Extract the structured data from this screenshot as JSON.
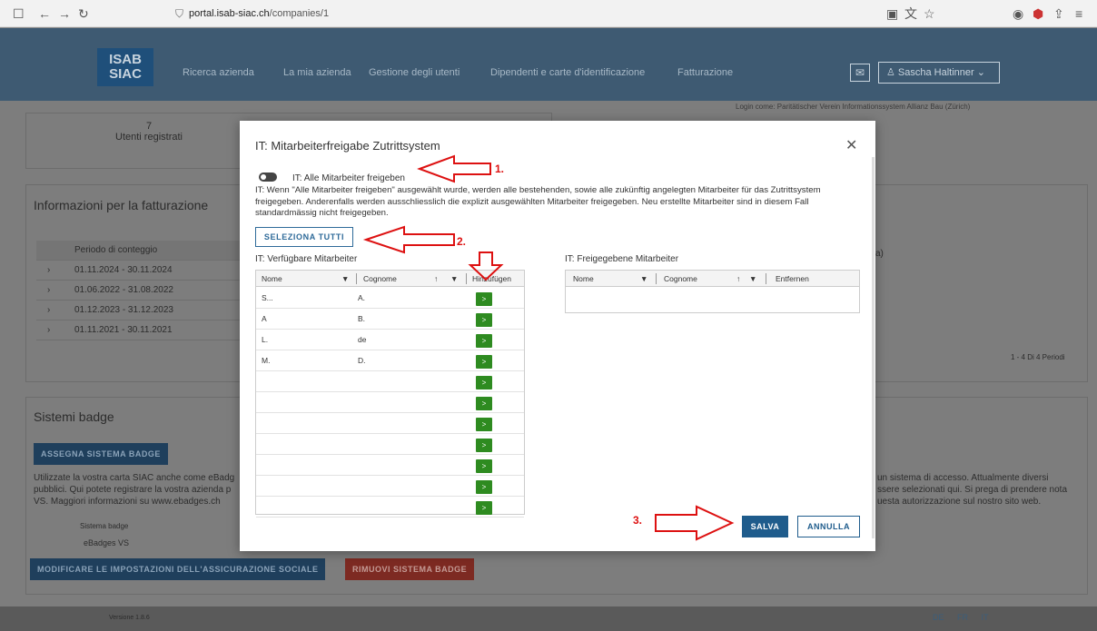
{
  "browser": {
    "url_domain": "portal.isab-siac.ch",
    "url_path": "/companies/1"
  },
  "header": {
    "logo_line1": "ISAB",
    "logo_line2": "SIAC",
    "nav": [
      "Ricerca azienda",
      "La mia azienda",
      "Gestione degli utenti",
      "Dipendenti e carte d'identificazione",
      "Fatturazione"
    ],
    "user": "Sascha Haltinner",
    "login_line": "Login come: Paritätischer Verein Informationssystem Allianz Bau (Zürich)"
  },
  "background": {
    "users_count": "7",
    "users_label": "Utenti registrati",
    "billing_title": "Informazioni per la fatturazione",
    "period_header": "Periodo di conteggio",
    "periods": [
      "01.11.2024 - 30.11.2024",
      "01.06.2022 - 31.08.2022",
      "01.12.2023 - 31.12.2023",
      "01.11.2021 - 30.11.2021"
    ],
    "paging": "1 - 4 Di 4 Periodi",
    "badge_title": "Sistemi badge",
    "assign_btn": "ASSEGNA SISTEMA BADGE",
    "badge_text_1": "Utilizzate la vostra carta SIAC anche come eBadg",
    "badge_text_2": "pubblici. Qui potete registrare la vostra azienda p",
    "badge_text_3": "VS. Maggiori informazioni su www.ebadges.ch",
    "badge_text_r1": "un sistema di accesso. Attualmente diversi",
    "badge_text_r2": "ssere selezionati qui. Si prega di prendere nota",
    "badge_text_r3": "uesta autorizzazione sul nostro sito web.",
    "badge_sys_header": "Sistema badge",
    "badge_sys_value": "eBadges VS",
    "social_btn": "MODIFICARE LE IMPOSTAZIONI DELL'ASSICURAZIONE SOCIALE",
    "remove_btn": "RIMUOVI SISTEMA BADGE",
    "right_frag": "a)",
    "version": "Versione 1.8.6",
    "langs": "DE FR IT"
  },
  "modal": {
    "title": "IT: Mitarbeiterfreigabe Zutrittsystem",
    "toggle_label": "IT: Alle Mitarbeiter freigeben",
    "description": "IT: Wenn \"Alle Mitarbeiter freigeben\" ausgewählt wurde, werden alle bestehenden, sowie alle zukünftig angelegten Mitarbeiter für das Zutrittsystem freigegeben. Anderenfalls werden ausschliesslich die explizit ausgewählten Mitarbeiter freigegeben. Neu erstellte Mitarbeiter sind in diesem Fall standardmässig nicht freigegeben.",
    "select_all": "SELEZIONA TUTTI",
    "available_title": "IT: Verfügbare Mitarbeiter",
    "released_title": "IT: Freigegebene Mitarbeiter",
    "col_name": "Nome",
    "col_surname": "Cognome",
    "col_add": "Hinzufügen",
    "col_remove": "Entfernen",
    "rows": [
      {
        "name": "S...",
        "surname": "A."
      },
      {
        "name": "A",
        "surname": "B."
      },
      {
        "name": "L.",
        "surname": "de"
      },
      {
        "name": "M.",
        "surname": "D."
      },
      {
        "name": "",
        "surname": ""
      },
      {
        "name": "",
        "surname": ""
      },
      {
        "name": "",
        "surname": ""
      },
      {
        "name": "",
        "surname": ""
      },
      {
        "name": "",
        "surname": ""
      },
      {
        "name": "",
        "surname": ""
      },
      {
        "name": "",
        "surname": ""
      }
    ],
    "add_symbol": ">",
    "save": "SALVA",
    "cancel": "ANNULLA"
  },
  "annotations": {
    "a1": "1.",
    "a2": "2.",
    "a3": "3.",
    "color": "#dd1111"
  }
}
